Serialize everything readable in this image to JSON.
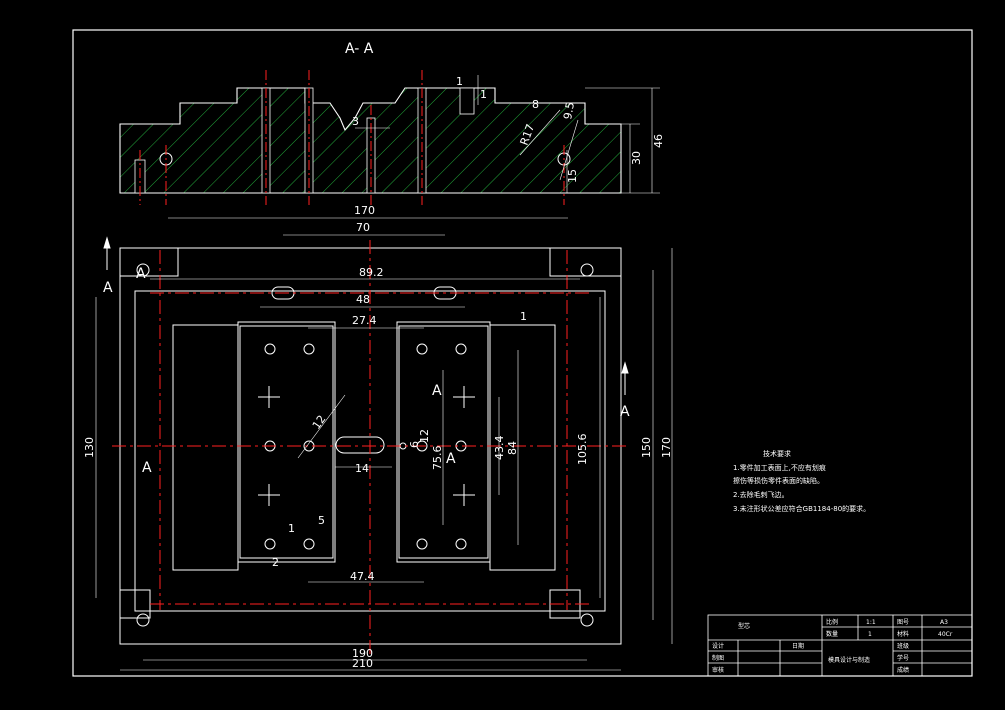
{
  "section_title": "A- A",
  "section_marks": [
    "A",
    "A",
    "A",
    "A",
    "A",
    "A"
  ],
  "section_view_dims": {
    "r17": "R17",
    "d9_5": "9.5",
    "d3": "3",
    "d1a": "1",
    "d1b": "1",
    "d8": "8",
    "d15": "15",
    "d30": "30",
    "d46": "46"
  },
  "plan_dims": {
    "d170_top": "170",
    "d70": "70",
    "d89_2": "89.2",
    "d48": "48",
    "d27_4": "27.4",
    "d1_right": "1",
    "d12": "12",
    "d14": "14",
    "d12b": "12",
    "d6": "6",
    "d43_4": "43.4",
    "d75_6": "75.6",
    "d84": "84",
    "d105_6": "105.6",
    "d150": "150",
    "d170_right": "170",
    "d130": "130",
    "d1_bottom": "1",
    "d5": "5",
    "d2": "2",
    "d47_4": "47.4",
    "d190": "190",
    "d210": "210"
  },
  "notes": {
    "heading": "技术要求",
    "lines": [
      "1.零件加工表面上,不应有划痕",
      "擦伤等损伤零件表面的缺陷。",
      "2.去除毛刺飞边。",
      "3.未注形状公差应符合GB1184-80的要求。"
    ]
  },
  "title_block": {
    "sheet_label": "型芯",
    "scale_label": "比例",
    "scale_value": "1:1",
    "qty_label": "数量",
    "qty_value": "1",
    "drawing_no_label": "图号",
    "drawing_no_value": "A3",
    "material_label": "材料",
    "material_value": "40Cr",
    "designer_label": "设计",
    "date_label": "日期",
    "drafter_label": "制图",
    "checker_label": "审核",
    "school": "模具设计与制造",
    "class_label": "班级",
    "student_no_label": "学号",
    "grade_label": "成绩"
  },
  "colors": {
    "outline": "#ffffff",
    "centerline": "#ff2020",
    "hatch": "#22a83a",
    "background": "#000000"
  }
}
